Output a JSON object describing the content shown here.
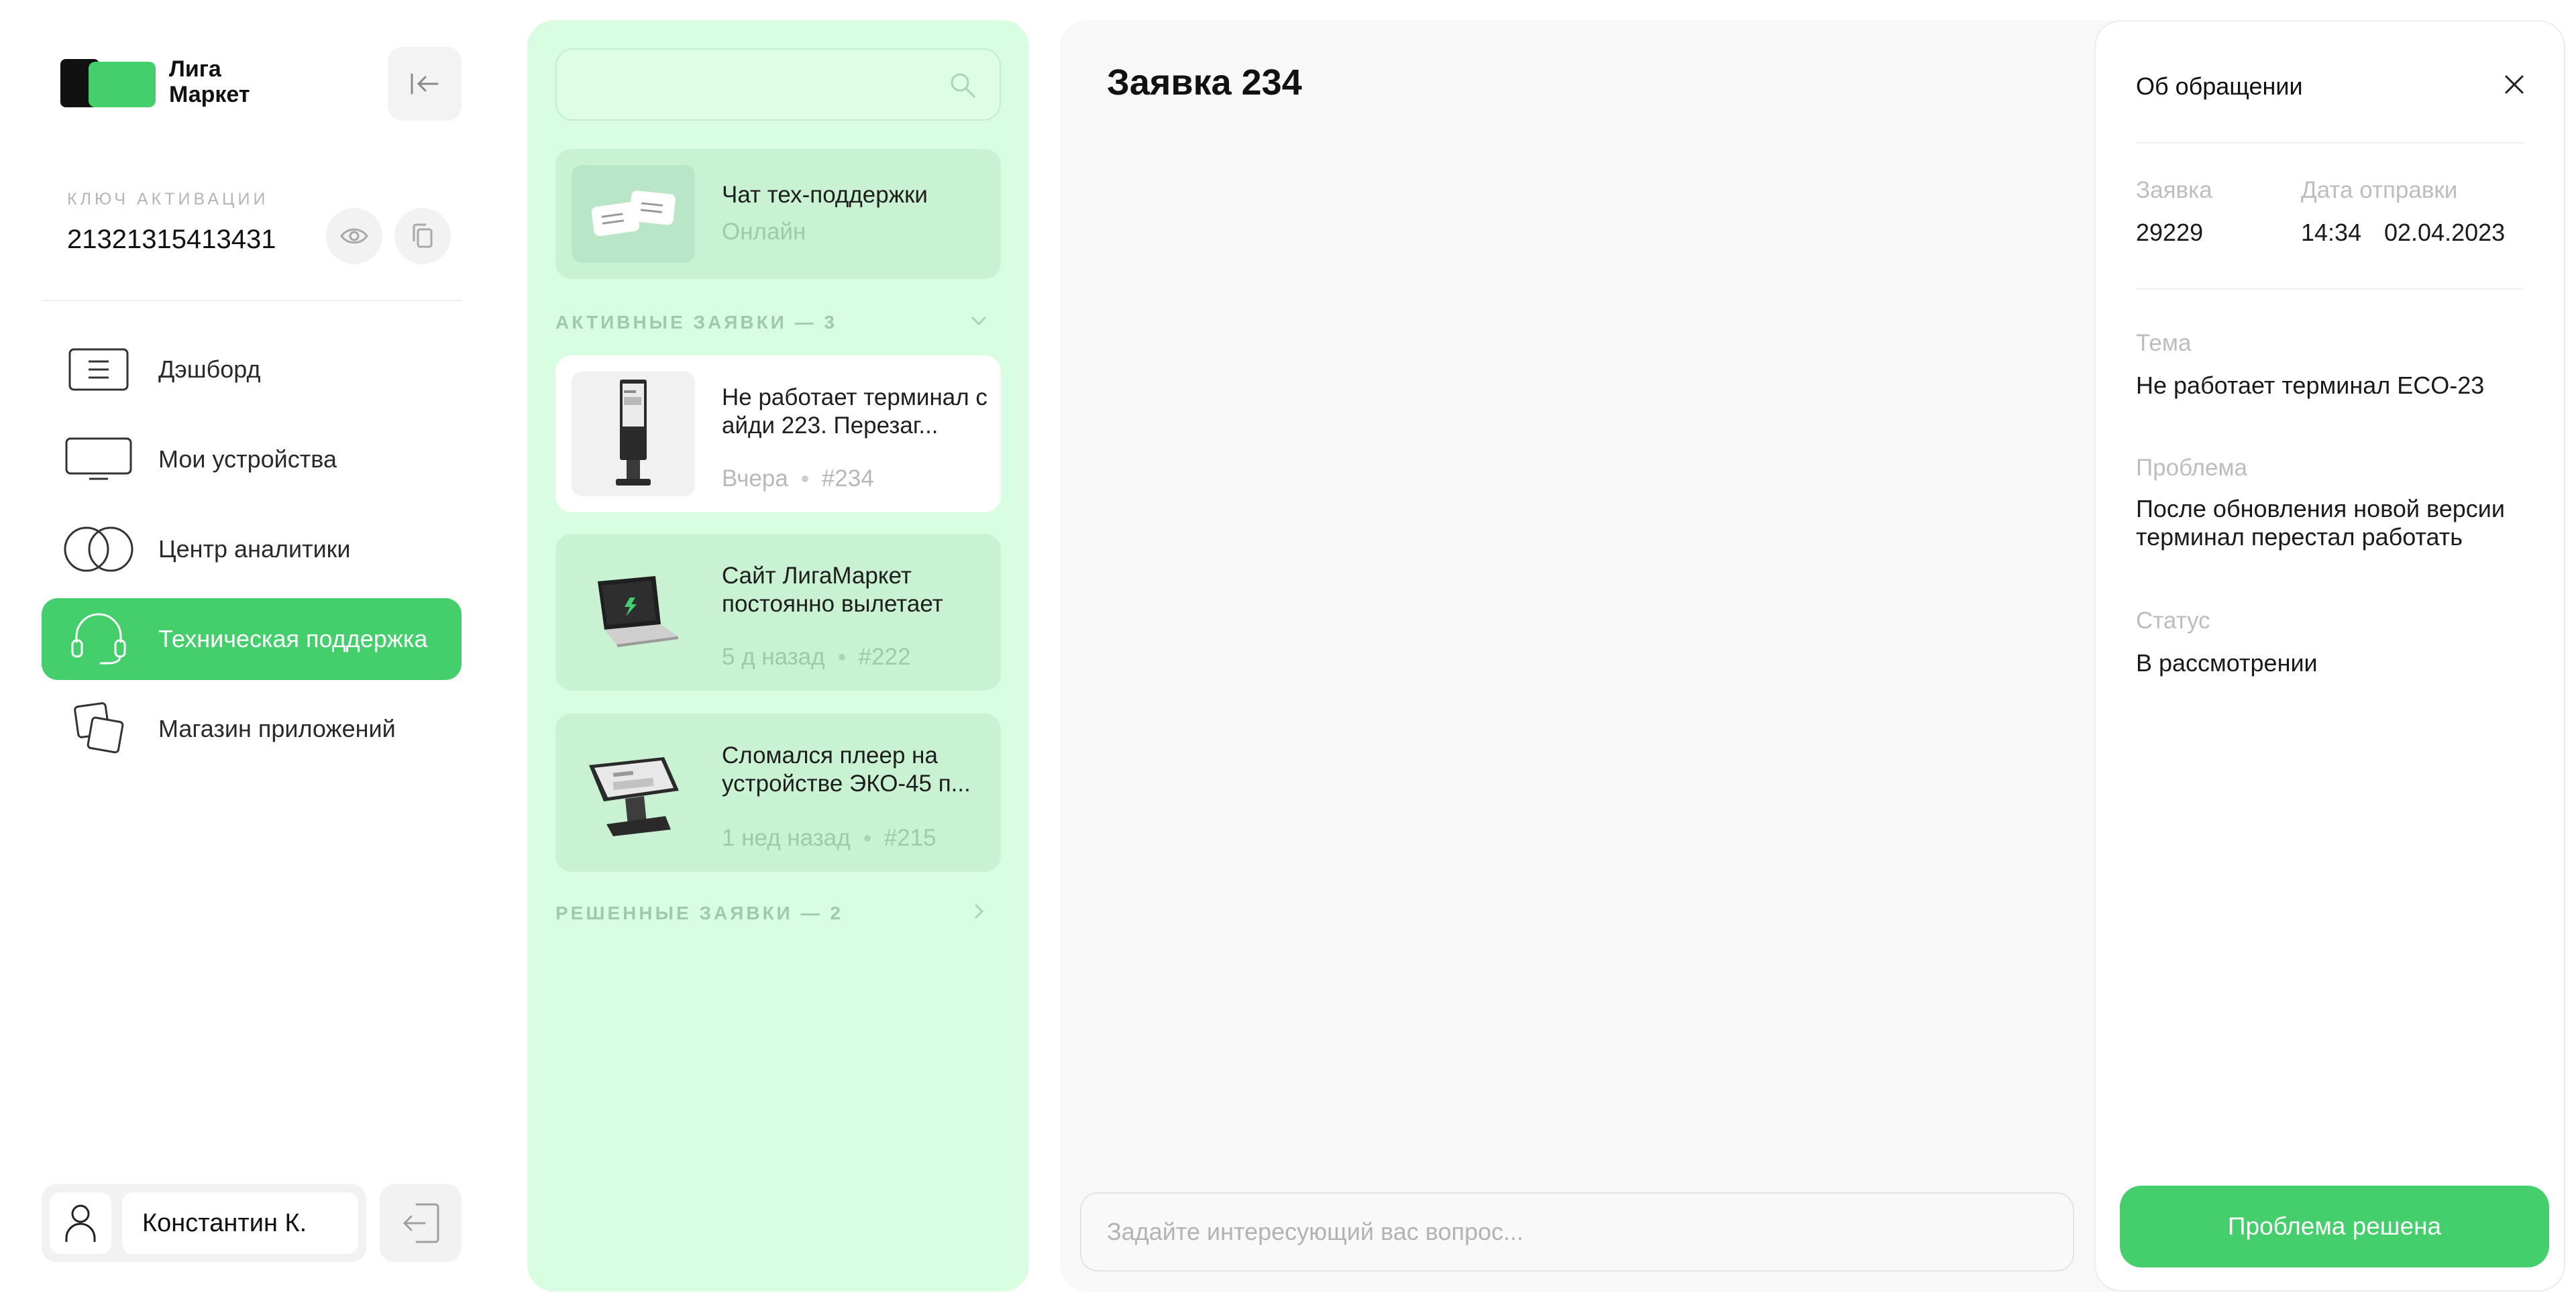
{
  "logo": {
    "line1": "Лига",
    "line2": "Маркет"
  },
  "activation": {
    "label": "КЛЮЧ АКТИВАЦИИ",
    "value": "21321315413431"
  },
  "nav": [
    {
      "label": "Дэшборд",
      "icon": "dashboard-icon"
    },
    {
      "label": "Мои устройства",
      "icon": "monitor-icon"
    },
    {
      "label": "Центр аналитики",
      "icon": "analytics-icon"
    },
    {
      "label": "Техническая поддержка",
      "icon": "headset-icon",
      "active": true
    },
    {
      "label": "Магазин приложений",
      "icon": "app-store-icon"
    }
  ],
  "user": {
    "name": "Константин К."
  },
  "support_chat": {
    "title": "Чат тех-поддержки",
    "status": "Онлайн"
  },
  "active_section": {
    "label": "АКТИВНЫЕ ЗАЯВКИ — 3"
  },
  "tickets": [
    {
      "title": "Не работает терминал с айди 223. Перезаг...",
      "time": "Вчера",
      "number": "#234",
      "thumb": "kiosk-image"
    },
    {
      "title": "Сайт ЛигаМаркет постоянно вылетает",
      "time": "5 д назад",
      "number": "#222",
      "thumb": "laptop-image"
    },
    {
      "title": "Сломался плеер на устройстве ЭКО-45 п...",
      "time": "1 нед назад",
      "number": "#215",
      "thumb": "pos-terminal-image"
    }
  ],
  "resolved_section": {
    "label": "РЕШЕННЫЕ ЗАЯВКИ — 2"
  },
  "chat": {
    "title": "Заявка 234",
    "input_placeholder": "Задайте интересующий вас вопрос..."
  },
  "details": {
    "title": "Об обращении",
    "ticket_label": "Заявка",
    "ticket_value": "29229",
    "date_label": "Дата отправки",
    "time_value": "14:34",
    "date_value": "02.04.2023",
    "topic_label": "Тема",
    "topic_value": "Не работает терминал ECO-23",
    "problem_label": "Проблема",
    "problem_value": "После обновления новой версии терминал перестал работать",
    "status_label": "Статус",
    "status_value": "В рассмотрении",
    "resolve_button": "Проблема решена"
  },
  "colors": {
    "accent": "#44cf6c",
    "list_bg": "#d8fde0",
    "card_bg": "#c9f2d3"
  }
}
